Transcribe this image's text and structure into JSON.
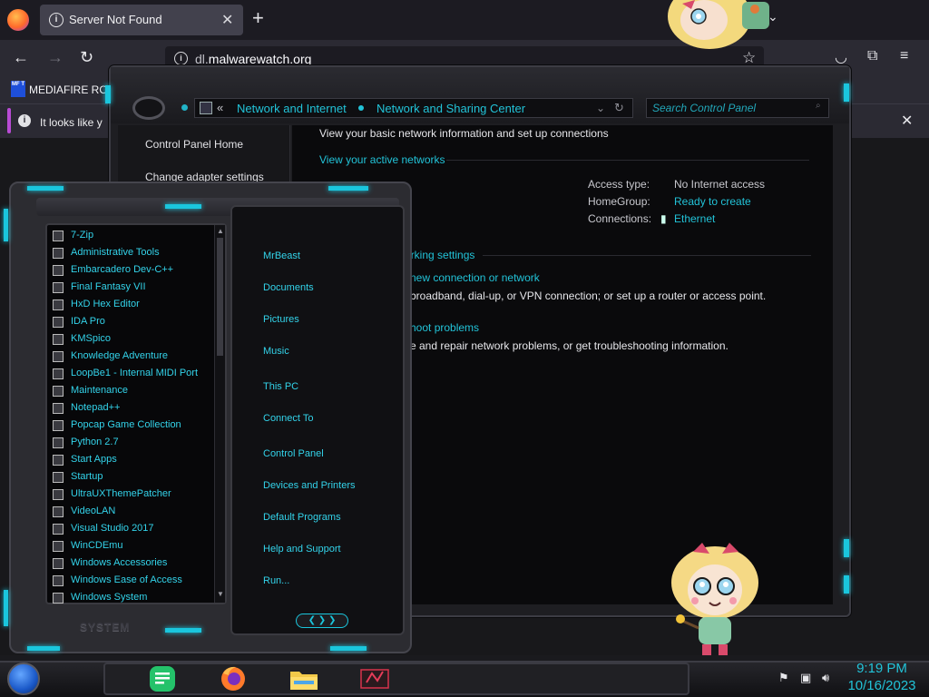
{
  "browser": {
    "tab_title": "Server Not Found",
    "url_domain": "malwarewatch.org",
    "url_prefix": "dl.",
    "bookmark_label": "MEDIAFIRE RO",
    "bookmark_icon_text": "MF T",
    "notification_text": "It looks like y"
  },
  "control_panel": {
    "breadcrumb_root": "«",
    "breadcrumb_1": "Network and Internet",
    "breadcrumb_2": "Network and Sharing Center",
    "search_placeholder": "Search Control Panel",
    "sidebar": [
      "Control Panel Home",
      "Change adapter settings"
    ],
    "heading": "View your basic network information and set up connections",
    "active_networks": "View your active networks",
    "access_type_label": "Access type:",
    "access_type_value": "No Internet access",
    "homegroup_label": "HomeGroup:",
    "homegroup_value": "Ready to create",
    "connections_label": "Connections:",
    "connections_value": "Ethernet",
    "section_title": "orking settings",
    "new_connection": "new connection or network",
    "new_connection_desc": "broadband, dial-up, or VPN connection; or set up a router or access point.",
    "troubleshoot": "hoot problems",
    "troubleshoot_desc": "e and repair network problems, or get troubleshooting information."
  },
  "start_menu": {
    "programs": [
      "7-Zip",
      "Administrative Tools",
      "Embarcadero Dev-C++",
      "Final Fantasy VII",
      "HxD Hex Editor",
      "IDA Pro",
      "KMSpico",
      "Knowledge Adventure",
      "LoopBe1 - Internal MIDI Port",
      "Maintenance",
      "Notepad++",
      "Popcap Game Collection",
      "Python 2.7",
      "Start Apps",
      "Startup",
      "UltraUXThemePatcher",
      "VideoLAN",
      "Visual Studio 2017",
      "WinCDEmu",
      "Windows Accessories",
      "Windows Ease of Access",
      "Windows System"
    ],
    "places": [
      "MrBeast",
      "Documents",
      "Pictures",
      "Music",
      "This PC",
      "Connect To",
      "Control Panel",
      "Devices and Printers",
      "Default Programs",
      "Help and Support",
      "Run..."
    ],
    "footer_label": "SYSTEM"
  },
  "taskbar": {
    "time": "9:19 PM",
    "date": "10/16/2023"
  },
  "colors": {
    "accent_cyan": "#1ac6dd",
    "link_cyan": "#22c3d8",
    "firefox_bg": "#1c1b22",
    "notification_accent": "#b94bd5"
  },
  "icons": {
    "firefox": "firefox-icon",
    "info": "info-icon",
    "close": "close-icon",
    "new_tab": "plus-icon",
    "back": "arrow-left-icon",
    "forward": "arrow-right-icon",
    "reload": "reload-icon",
    "bookmark_star": "star-icon",
    "pocket": "pocket-icon",
    "extensions": "puzzle-icon",
    "menu": "hamburger-icon",
    "ethernet": "ethernet-icon",
    "start": "start-orb-icon"
  }
}
